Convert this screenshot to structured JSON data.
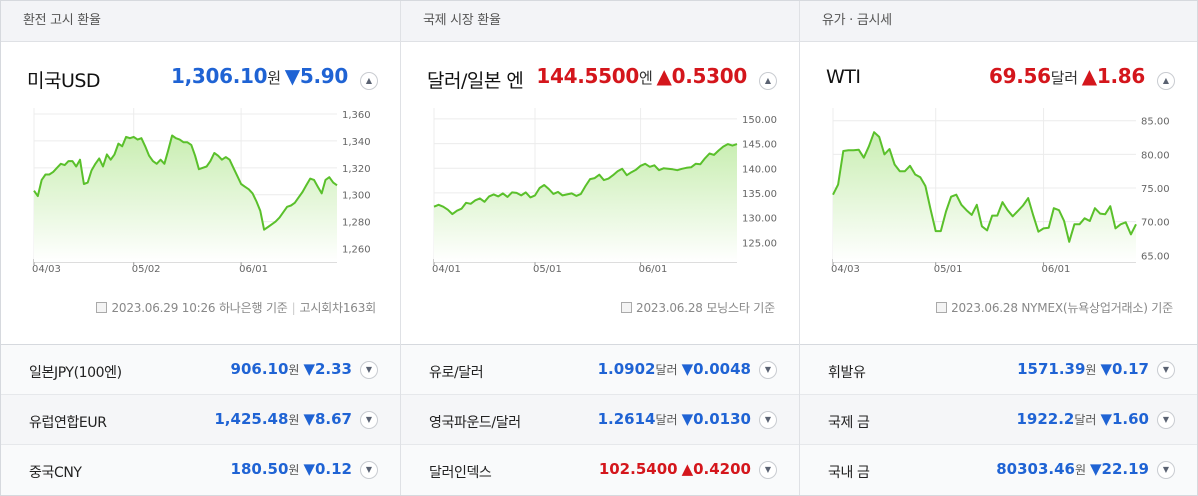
{
  "colors": {
    "down": "#1f63d4",
    "up": "#d4161c",
    "area_top": "#c9eeb2",
    "line": "#5ac02b"
  },
  "panels": [
    {
      "header": "환전 고시 환율",
      "main": {
        "name": "미국USD",
        "value": "1,306.10",
        "unit": "원",
        "change": "▼5.90",
        "direction": "down",
        "toggle_icon": "▲"
      },
      "source": {
        "text": "2023.06.29 10:26 하나은행 기준",
        "separator": "|",
        "extra": "고시회차163회"
      },
      "rows": [
        {
          "name": "일본JPY(100엔)",
          "value": "906.10",
          "unit": "원",
          "change": "▼2.33",
          "direction": "down",
          "toggle_icon": "▼"
        },
        {
          "name": "유럽연합EUR",
          "value": "1,425.48",
          "unit": "원",
          "change": "▼8.67",
          "direction": "down",
          "toggle_icon": "▼"
        },
        {
          "name": "중국CNY",
          "value": "180.50",
          "unit": "원",
          "change": "▼0.12",
          "direction": "down",
          "toggle_icon": "▼"
        }
      ]
    },
    {
      "header": "국제 시장 환율",
      "main": {
        "name": "달러/일본 엔",
        "value": "144.5500",
        "unit": "엔",
        "change": "▲0.5300",
        "direction": "up",
        "toggle_icon": "▲"
      },
      "source": {
        "text": "2023.06.28 모닝스타 기준",
        "separator": "",
        "extra": ""
      },
      "rows": [
        {
          "name": "유로/달러",
          "value": "1.0902",
          "unit": "달러",
          "change": "▼0.0048",
          "direction": "down",
          "toggle_icon": "▼"
        },
        {
          "name": "영국파운드/달러",
          "value": "1.2614",
          "unit": "달러",
          "change": "▼0.0130",
          "direction": "down",
          "toggle_icon": "▼"
        },
        {
          "name": "달러인덱스",
          "value": "102.5400",
          "unit": "",
          "change": "▲0.4200",
          "direction": "up",
          "toggle_icon": "▼"
        }
      ]
    },
    {
      "header": "유가 · 금시세",
      "main": {
        "name": "WTI",
        "value": "69.56",
        "unit": "달러",
        "change": "▲1.86",
        "direction": "up",
        "toggle_icon": "▲"
      },
      "source": {
        "text": "2023.06.28 NYMEX(뉴욕상업거래소) 기준",
        "separator": "",
        "extra": ""
      },
      "rows": [
        {
          "name": "휘발유",
          "value": "1571.39",
          "unit": "원",
          "change": "▼0.17",
          "direction": "down",
          "toggle_icon": "▼"
        },
        {
          "name": "국제 금",
          "value": "1922.2",
          "unit": "달러",
          "change": "▼1.60",
          "direction": "down",
          "toggle_icon": "▼"
        },
        {
          "name": "국내 금",
          "value": "80303.46",
          "unit": "원",
          "change": "▼22.19",
          "direction": "down",
          "toggle_icon": "▼"
        }
      ]
    }
  ],
  "chart_data": [
    {
      "type": "area",
      "ylim": [
        1250,
        1360
      ],
      "yticks": [
        1260,
        1280,
        1300,
        1320,
        1340,
        1360
      ],
      "ytick_labels": [
        "1,260",
        "1,280",
        "1,300",
        "1,320",
        "1,340",
        "1,360"
      ],
      "xticks": [
        0,
        26,
        54
      ],
      "xtick_labels": [
        "04/03",
        "05/02",
        "06/01"
      ],
      "x_count": 80,
      "values": [
        1303,
        1299,
        1311,
        1315,
        1315,
        1317,
        1320,
        1323,
        1322,
        1325,
        1325,
        1321,
        1326,
        1308,
        1309,
        1318,
        1323,
        1327,
        1321,
        1330,
        1326,
        1330,
        1338,
        1336,
        1343,
        1342,
        1343,
        1341,
        1342,
        1336,
        1329,
        1325,
        1323,
        1326,
        1323,
        1333,
        1344,
        1342,
        1341,
        1339,
        1339,
        1337,
        1329,
        1319,
        1320,
        1321,
        1325,
        1331,
        1329,
        1326,
        1328,
        1326,
        1320,
        1314,
        1308,
        1306,
        1304,
        1301,
        1295,
        1288,
        1274,
        1276,
        1278,
        1280,
        1283,
        1287,
        1291,
        1292,
        1294,
        1298,
        1302,
        1307,
        1312,
        1311,
        1306,
        1301,
        1311,
        1313,
        1309,
        1307
      ],
      "grid": true
    },
    {
      "type": "area",
      "ylim": [
        121,
        151
      ],
      "yticks": [
        125,
        130,
        135,
        140,
        145,
        150
      ],
      "ytick_labels": [
        "125.00",
        "130.00",
        "135.00",
        "140.00",
        "145.00",
        "150.00"
      ],
      "xticks": [
        0,
        22,
        45
      ],
      "xtick_labels": [
        "04/01",
        "05/01",
        "06/01"
      ],
      "x_count": 67,
      "values": [
        132.2,
        132.6,
        132.2,
        131.6,
        130.7,
        131.4,
        131.8,
        133.0,
        132.8,
        133.5,
        133.9,
        133.2,
        134.3,
        134.7,
        134.3,
        134.9,
        134.2,
        135.1,
        135.0,
        134.5,
        135.1,
        134.1,
        134.5,
        136.0,
        136.6,
        135.8,
        134.8,
        135.2,
        134.5,
        134.7,
        134.9,
        134.4,
        134.8,
        136.4,
        137.8,
        138.0,
        138.7,
        137.6,
        137.9,
        138.6,
        139.4,
        139.9,
        138.6,
        139.2,
        139.7,
        140.5,
        140.9,
        140.3,
        140.6,
        139.6,
        140.0,
        139.9,
        139.8,
        139.6,
        139.9,
        140.1,
        140.2,
        140.9,
        140.8,
        142.0,
        143.0,
        142.7,
        143.6,
        144.4,
        144.9,
        144.6,
        144.9
      ],
      "grid": true
    },
    {
      "type": "area",
      "ylim": [
        64,
        86
      ],
      "yticks": [
        65,
        70,
        75,
        80,
        85
      ],
      "ytick_labels": [
        "65.00",
        "70.00",
        "75.00",
        "80.00",
        "85.00"
      ],
      "xticks": [
        0,
        20,
        41
      ],
      "xtick_labels": [
        "04/03",
        "05/01",
        "06/01"
      ],
      "x_count": 60,
      "values": [
        74.0,
        75.5,
        80.5,
        80.6,
        80.6,
        80.7,
        79.5,
        81.2,
        83.3,
        82.6,
        80.0,
        80.8,
        78.5,
        77.5,
        77.5,
        78.3,
        77.0,
        76.6,
        75.3,
        71.8,
        68.6,
        68.6,
        71.5,
        73.7,
        74.0,
        72.5,
        71.7,
        71.0,
        72.5,
        69.3,
        68.7,
        70.9,
        70.9,
        72.9,
        71.7,
        70.8,
        71.6,
        72.4,
        73.5,
        70.9,
        68.5,
        69.0,
        69.1,
        72.0,
        71.7,
        70.1,
        67.0,
        69.6,
        69.6,
        70.5,
        70.1,
        72.0,
        71.2,
        71.1,
        72.3,
        69.0,
        69.6,
        69.9,
        68.1,
        69.6
      ],
      "grid": true
    }
  ]
}
